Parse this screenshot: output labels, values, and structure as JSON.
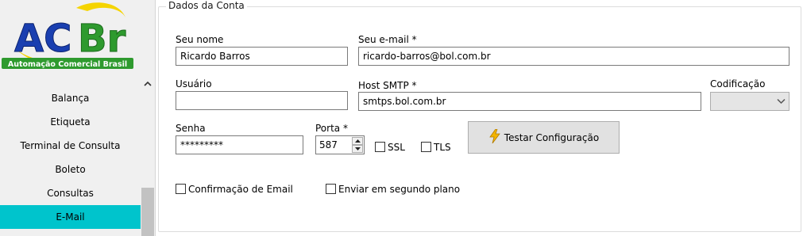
{
  "logo": {
    "text_ac": "AC",
    "text_br": "Br",
    "tagline": "Automação Comercial Brasil",
    "colors": {
      "blue": "#1a3fb0",
      "green": "#2e9a2e",
      "yellow": "#f5d400"
    }
  },
  "sidebar": {
    "items": [
      {
        "label": "Balança",
        "active": false
      },
      {
        "label": "Etiqueta",
        "active": false
      },
      {
        "label": "Terminal de Consulta",
        "active": false
      },
      {
        "label": "Boleto",
        "active": false
      },
      {
        "label": "Consultas",
        "active": false
      },
      {
        "label": "E-Mail",
        "active": true
      }
    ],
    "active_color": "#00c4cc"
  },
  "account": {
    "legend": "Dados da Conta",
    "name_label": "Seu nome",
    "name_value": "Ricardo Barros",
    "email_label": "Seu e-mail *",
    "email_value": "ricardo-barros@bol.com.br",
    "user_label": "Usuário",
    "user_value": "",
    "smtp_label": "Host SMTP *",
    "smtp_value": "smtps.bol.com.br",
    "encoding_label": "Codificação",
    "encoding_value": "",
    "password_label": "Senha",
    "password_value": "*********",
    "port_label": "Porta *",
    "port_value": "587",
    "ssl_label": "SSL",
    "ssl_checked": false,
    "tls_label": "TLS",
    "tls_checked": false,
    "test_button_label": "Testar Configuração",
    "confirm_label": "Confirmação de Email",
    "confirm_checked": false,
    "background_label": "Enviar em segundo plano",
    "background_checked": false
  }
}
